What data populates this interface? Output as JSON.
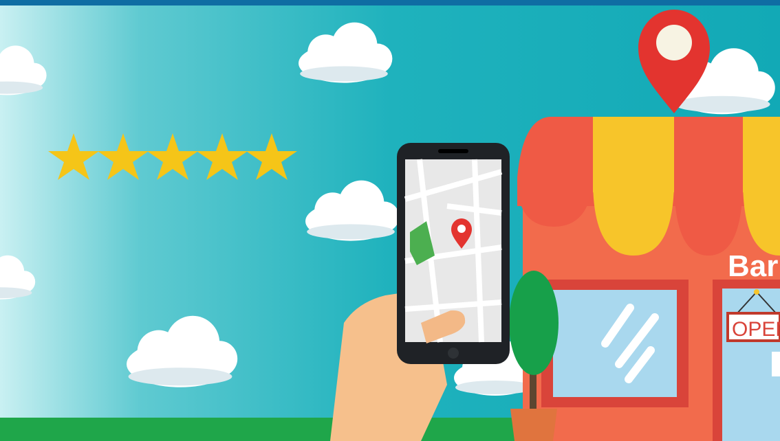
{
  "colors": {
    "sky_light": "#c9f0f2",
    "sky_mid": "#25b8c2",
    "sky_dark": "#12a9b6",
    "top_bar": "#0f6da3",
    "grass": "#1fa64a",
    "star": "#f5c518",
    "awning_red": "#ef5a45",
    "awning_yellow": "#f7c52a",
    "shop_wall": "#f26b4c",
    "window_frame": "#d9443a",
    "window_glass": "#a9d8ee",
    "pin_red": "#e3342f",
    "map_green": "#4caf50",
    "skin": "#f6c08c"
  },
  "rating": {
    "stars": 5,
    "max": 5
  },
  "shop": {
    "sign_text": "Bar",
    "door_sign": "OPEN"
  },
  "icons": [
    "location-pin-icon",
    "star-icon",
    "smartphone-icon",
    "map-pin-icon"
  ]
}
